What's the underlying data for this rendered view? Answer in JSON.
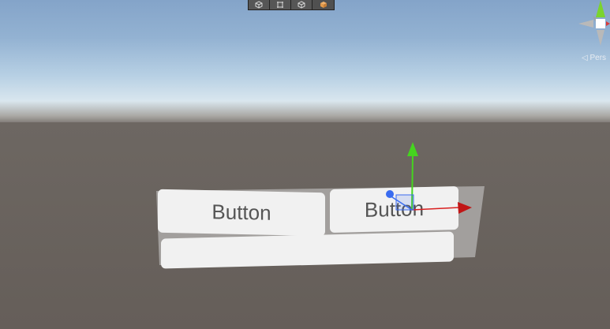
{
  "toolbar": {
    "tools": [
      {
        "icon": "wire-cube-icon"
      },
      {
        "icon": "rect-tool-icon"
      },
      {
        "icon": "wire-cube-icon"
      },
      {
        "icon": "solid-cube-icon"
      }
    ]
  },
  "scene_gizmo": {
    "persp_label": "◁ Pers"
  },
  "scene": {
    "button_left_label": "Button",
    "button_right_label": "Button"
  },
  "colors": {
    "sky_top": "#84a4c9",
    "horizon": "#d9e6ee",
    "ground": "#6a635e",
    "axis_x": "#d91f1f",
    "axis_y": "#41d41d",
    "axis_z": "#3a6cf0",
    "ui_button": "#f1f1f1",
    "panel": "#a29f9d"
  }
}
